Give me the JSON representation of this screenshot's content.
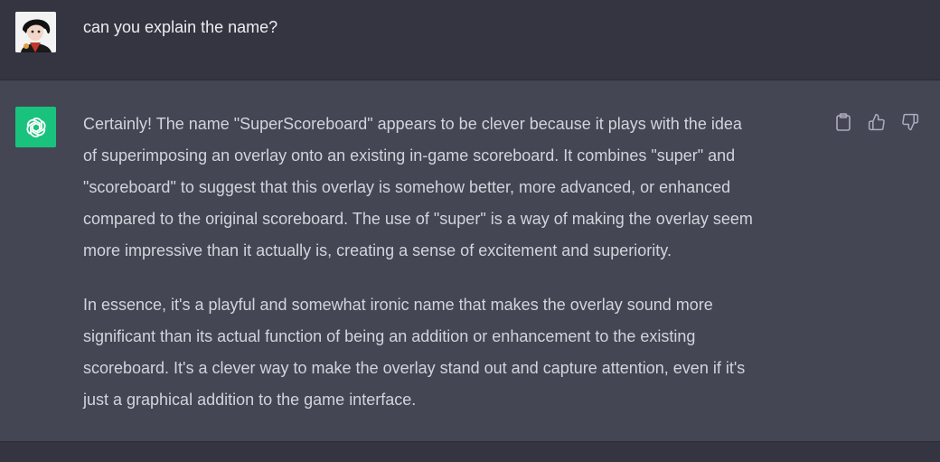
{
  "user_message": {
    "text": "can you explain the name?"
  },
  "assistant_message": {
    "paragraphs": [
      {
        "lines": [
          "Certainly! The name \"SuperScoreboard\" appears to be clever because it plays with the idea",
          "of superimposing an overlay onto an existing in-game scoreboard. It combines \"super\" and",
          "\"scoreboard\" to suggest that this overlay is somehow better, more advanced, or enhanced",
          "compared to the original scoreboard. The use of \"super\" is a way of making the overlay seem",
          "more impressive than it actually is, creating a sense of excitement and superiority."
        ]
      },
      {
        "lines": [
          "In essence, it's a playful and somewhat ironic name that makes the overlay sound more",
          "significant than its actual function of being an addition or enhancement to the existing",
          "scoreboard. It's a clever way to make the overlay stand out and capture attention, even if it's",
          "just a graphical addition to the game interface."
        ]
      }
    ],
    "actions": [
      {
        "icon": "clipboard-icon"
      },
      {
        "icon": "thumbs-up-icon"
      },
      {
        "icon": "thumbs-down-icon"
      }
    ]
  },
  "colors": {
    "background": "#343541",
    "assistant_row": "#444654",
    "brand_green": "#19c37d",
    "user_text": "#ececf1",
    "assistant_text": "#d1d5db",
    "icon": "#acacbe"
  }
}
